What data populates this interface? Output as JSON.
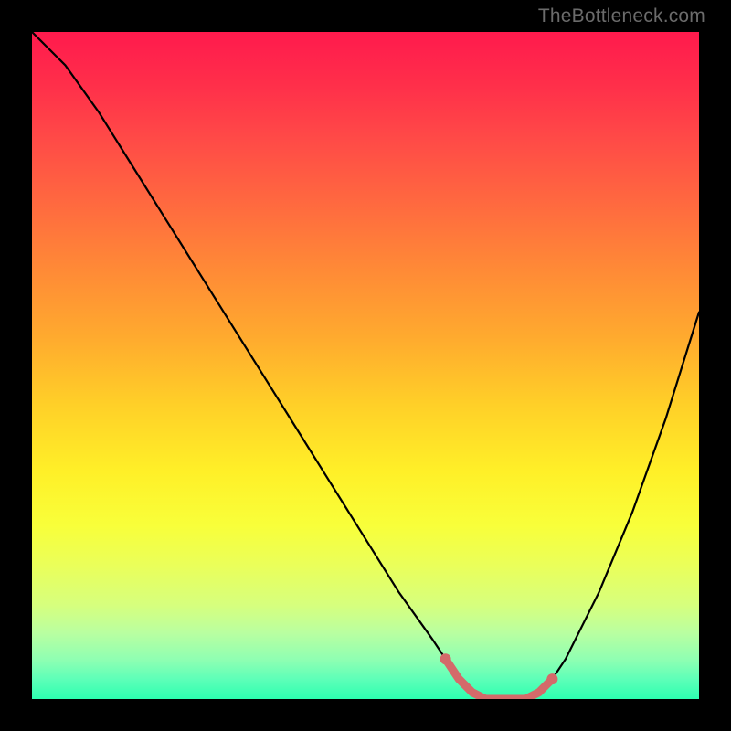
{
  "watermark": "TheBottleneck.com",
  "chart_data": {
    "type": "line",
    "title": "",
    "xlabel": "",
    "ylabel": "",
    "xlim": [
      0,
      100
    ],
    "ylim": [
      0,
      100
    ],
    "series": [
      {
        "name": "bottleneck-curve",
        "x": [
          0,
          5,
          10,
          15,
          20,
          25,
          30,
          35,
          40,
          45,
          50,
          55,
          60,
          62,
          64,
          66,
          68,
          70,
          72,
          74,
          76,
          78,
          80,
          85,
          90,
          95,
          100
        ],
        "values": [
          100,
          95,
          88,
          80,
          72,
          64,
          56,
          48,
          40,
          32,
          24,
          16,
          9,
          6,
          3,
          1,
          0,
          0,
          0,
          0,
          1,
          3,
          6,
          16,
          28,
          42,
          58
        ]
      }
    ],
    "highlight": {
      "name": "optimal-region",
      "color": "#d46a6a",
      "x": [
        62,
        64,
        66,
        68,
        70,
        72,
        74,
        76,
        78
      ],
      "values": [
        6,
        3,
        1,
        0,
        0,
        0,
        0,
        1,
        3
      ]
    }
  }
}
